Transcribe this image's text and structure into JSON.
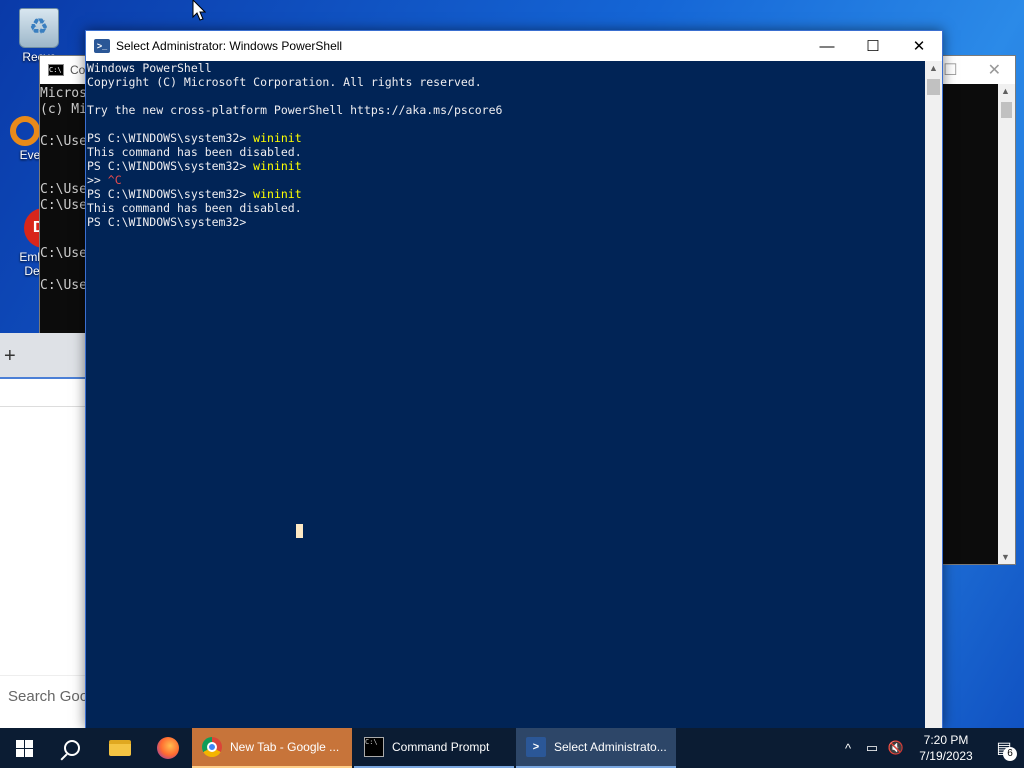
{
  "desktop": {
    "icons": [
      {
        "label": "Recycle Bin",
        "visible": "Recyc"
      },
      {
        "label": "Every",
        "visible": "Every"
      },
      {
        "label": "Embar Dev-",
        "visible": "Embar\nDev-"
      }
    ]
  },
  "cmd_window": {
    "title": "Co",
    "lines": [
      "Micros",
      "(c) Mi",
      "",
      "C:\\Use",
      "",
      "",
      "C:\\Use",
      "C:\\Use",
      "",
      "",
      "C:\\Use",
      "",
      "C:\\Use"
    ]
  },
  "browser": {
    "new_tab_symbol": "+",
    "search_placeholder": "Search Goo"
  },
  "powershell": {
    "title": "Select Administrator: Windows PowerShell",
    "minimize": "—",
    "maximize": "☐",
    "close": "✕",
    "lines": [
      {
        "text": "Windows PowerShell"
      },
      {
        "text": "Copyright (C) Microsoft Corporation. All rights reserved."
      },
      {
        "text": ""
      },
      {
        "text": "Try the new cross-platform PowerShell https://aka.ms/pscore6"
      },
      {
        "text": ""
      },
      {
        "prompt": "PS C:\\WINDOWS\\system32> ",
        "cmd": "wininit"
      },
      {
        "text": "This command has been disabled."
      },
      {
        "prompt": "PS C:\\WINDOWS\\system32> ",
        "cmd": "wininit"
      },
      {
        "prompt": ">> ",
        "ctrl": "^C"
      },
      {
        "prompt": "PS C:\\WINDOWS\\system32> ",
        "cmd": "wininit"
      },
      {
        "text": "This command has been disabled."
      },
      {
        "prompt": "PS C:\\WINDOWS\\system32> "
      }
    ]
  },
  "taskbar": {
    "apps": [
      {
        "name": "chrome",
        "label": "New Tab - Google ..."
      },
      {
        "name": "cmd",
        "label": "Command Prompt"
      },
      {
        "name": "powershell",
        "label": "Select Administrato..."
      }
    ],
    "time": "7:20 PM",
    "date": "7/19/2023",
    "notification_count": "6"
  },
  "colors": {
    "ps_background": "#012456",
    "ps_command": "#ffff00",
    "ps_ctrl": "#e84c4c"
  }
}
